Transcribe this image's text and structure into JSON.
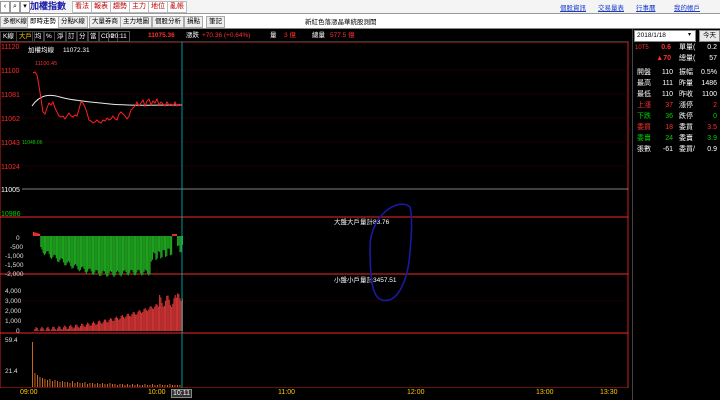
{
  "toolbar": {
    "title": "加權指數",
    "buttons": [
      "看法",
      "報表",
      "趨勢",
      "主力",
      "地位",
      "亂帳"
    ],
    "links": [
      "個股資訊",
      "交易量表",
      "行事曆",
      "我的帳戶"
    ]
  },
  "tabs": {
    "items": [
      "多根K線",
      "即時走勢",
      "分點K線",
      "大量券商",
      "主力地圖",
      "個股分析",
      "損點",
      "筆記"
    ],
    "active_index": 1,
    "message": "新紅色落漲晶華統股測開"
  },
  "infobar": {
    "items": [
      {
        "label": "K線",
        "color": "#ffffff"
      },
      {
        "label": "大戶",
        "color": "#ffcc00"
      },
      {
        "label": "均",
        "color": "#ffffff"
      },
      {
        "label": "%",
        "color": "#ffffff"
      },
      {
        "label": "淨",
        "color": "#ffffff"
      },
      {
        "label": "訂",
        "color": "#ffffff"
      },
      {
        "label": "分",
        "color": "#ffffff"
      },
      {
        "label": "當",
        "color": "#ffffff"
      },
      {
        "label": "CDP",
        "color": "#ffffff"
      }
    ],
    "time": "10:11",
    "price": "11075.36",
    "change_label": "漲跌",
    "change": "+70.36 (+0.64%)",
    "volume_label": "量",
    "volume": "3 億",
    "total_label": "總量",
    "total": "577.5 億"
  },
  "price_panel": {
    "legend": "加權均線",
    "legend_value": "11072.31",
    "high_mark": "11100.45",
    "low_mark": "11048.06",
    "y_ticks": [
      "11120",
      "11100",
      "11081",
      "11062",
      "11043",
      "11024",
      "11005",
      "10986"
    ],
    "ref_value": "11005"
  },
  "panel_big": {
    "label": "大盤大戶量計",
    "value": "83.76",
    "y_ticks": [
      "0",
      "-500",
      "-1,000",
      "-1,500",
      "-2,000"
    ]
  },
  "panel_small": {
    "label": "小盤小戶量計",
    "value": "3457.51",
    "y_ticks": [
      "4,000",
      "3,000",
      "2,000",
      "1,000",
      "0"
    ]
  },
  "panel_vol": {
    "y_ticks": [
      "59.4",
      "21.4"
    ]
  },
  "time_axis": {
    "labels": [
      "09:00",
      "10:00",
      "10:11",
      "11:00",
      "12:00",
      "13:00",
      "13:30"
    ]
  },
  "date_selector": {
    "value": "2018/1/18",
    "button": "今天"
  },
  "quote": {
    "head": [
      {
        "left": "10T5",
        "mid": "0.6",
        "mid_color": "#ff3030",
        "label": "單量(",
        "val": "0.2"
      },
      {
        "left": "",
        "mid": "▲70",
        "mid_color": "#ff3030",
        "label": "總量(",
        "val": "57"
      }
    ],
    "rows": [
      {
        "l1": "開盤",
        "v1": "110",
        "l2": "振幅",
        "v2": "0.5%",
        "c1": "#ffffff"
      },
      {
        "l1": "最高",
        "v1": "111",
        "l2": "昨量",
        "v2": "1486",
        "c1": "#ffffff"
      },
      {
        "l1": "最低",
        "v1": "110",
        "l2": "昨收",
        "v2": "1100",
        "c1": "#ffffff"
      },
      {
        "l1": "上漲",
        "v1": "37",
        "l2": "漲停",
        "v2": "2",
        "c1": "#ff3030"
      },
      {
        "l1": "下跌",
        "v1": "36",
        "l2": "跌停",
        "v2": "0",
        "c1": "#00d000"
      },
      {
        "l1": "委買",
        "v1": "18",
        "l2": "委買",
        "v2": "3.5",
        "c1": "#ff3030"
      },
      {
        "l1": "委賣",
        "v1": "24",
        "l2": "委賣",
        "v2": "3.9",
        "c1": "#00d000"
      },
      {
        "l1": "張數",
        "v1": "-61",
        "l2": "委買/",
        "v2": "0.9",
        "c1": "#ffffff"
      }
    ]
  },
  "colors": {
    "up": "#ff3030",
    "down": "#00d000",
    "axis": "#ff2a2a",
    "cursor": "#00bfbf",
    "annotation": "#1a1aa0"
  }
}
